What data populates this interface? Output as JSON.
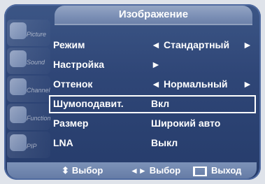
{
  "osd": {
    "title": "Изображение",
    "sidebar": [
      {
        "label": "Picture",
        "icon": "picture-icon"
      },
      {
        "label": "Sound",
        "icon": "sound-icon"
      },
      {
        "label": "Channel",
        "icon": "channel-icon"
      },
      {
        "label": "Function",
        "icon": "function-icon"
      },
      {
        "label": "PIP",
        "icon": "pip-icon"
      }
    ],
    "rows": [
      {
        "label": "Режим",
        "value": "Стандартный",
        "left_arrow": "◄",
        "right_arrow": "►"
      },
      {
        "label": "Настройка",
        "left_arrow": "►"
      },
      {
        "label": "Оттенок",
        "value": "Нормальный",
        "left_arrow": "◄",
        "right_arrow": "►"
      },
      {
        "label": "Шумоподавит.",
        "value": "Вкл"
      },
      {
        "label": "Размер",
        "value": "Широкий авто"
      },
      {
        "label": "LNA",
        "value": "Выкл"
      }
    ],
    "bottom": {
      "move_label": "Выбор",
      "select_label": "Выбор",
      "exit_label": "Выход",
      "move_icon": "updown-arrows-icon",
      "select_icon": "leftright-arrows-icon",
      "exit_icon": "exit-icon"
    }
  }
}
